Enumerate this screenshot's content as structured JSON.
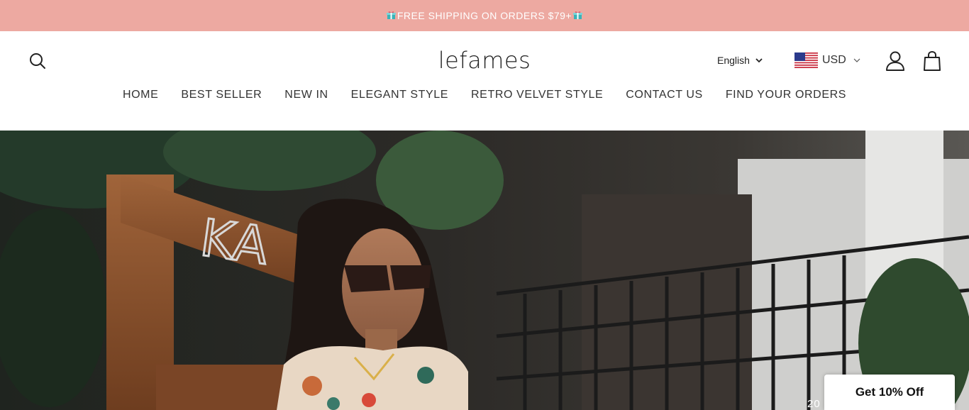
{
  "announcement": {
    "text": "FREE SHIPPING ON ORDERS $79+",
    "background": "#eda9a1"
  },
  "header": {
    "logo": "lefames",
    "language": "English",
    "currency": "USD"
  },
  "nav": [
    {
      "label": "HOME"
    },
    {
      "label": "BEST SELLER"
    },
    {
      "label": "NEW IN"
    },
    {
      "label": "ELEGANT STYLE"
    },
    {
      "label": "RETRO VELVET STYLE"
    },
    {
      "label": "CONTACT US"
    },
    {
      "label": "FIND YOUR ORDERS"
    }
  ],
  "hero": {
    "caption": "20"
  },
  "discount": {
    "label": "Get 10% Off"
  },
  "icons": [
    "search-icon",
    "chevron-down-icon",
    "us-flag-icon",
    "account-icon",
    "cart-icon",
    "gift-icon"
  ]
}
